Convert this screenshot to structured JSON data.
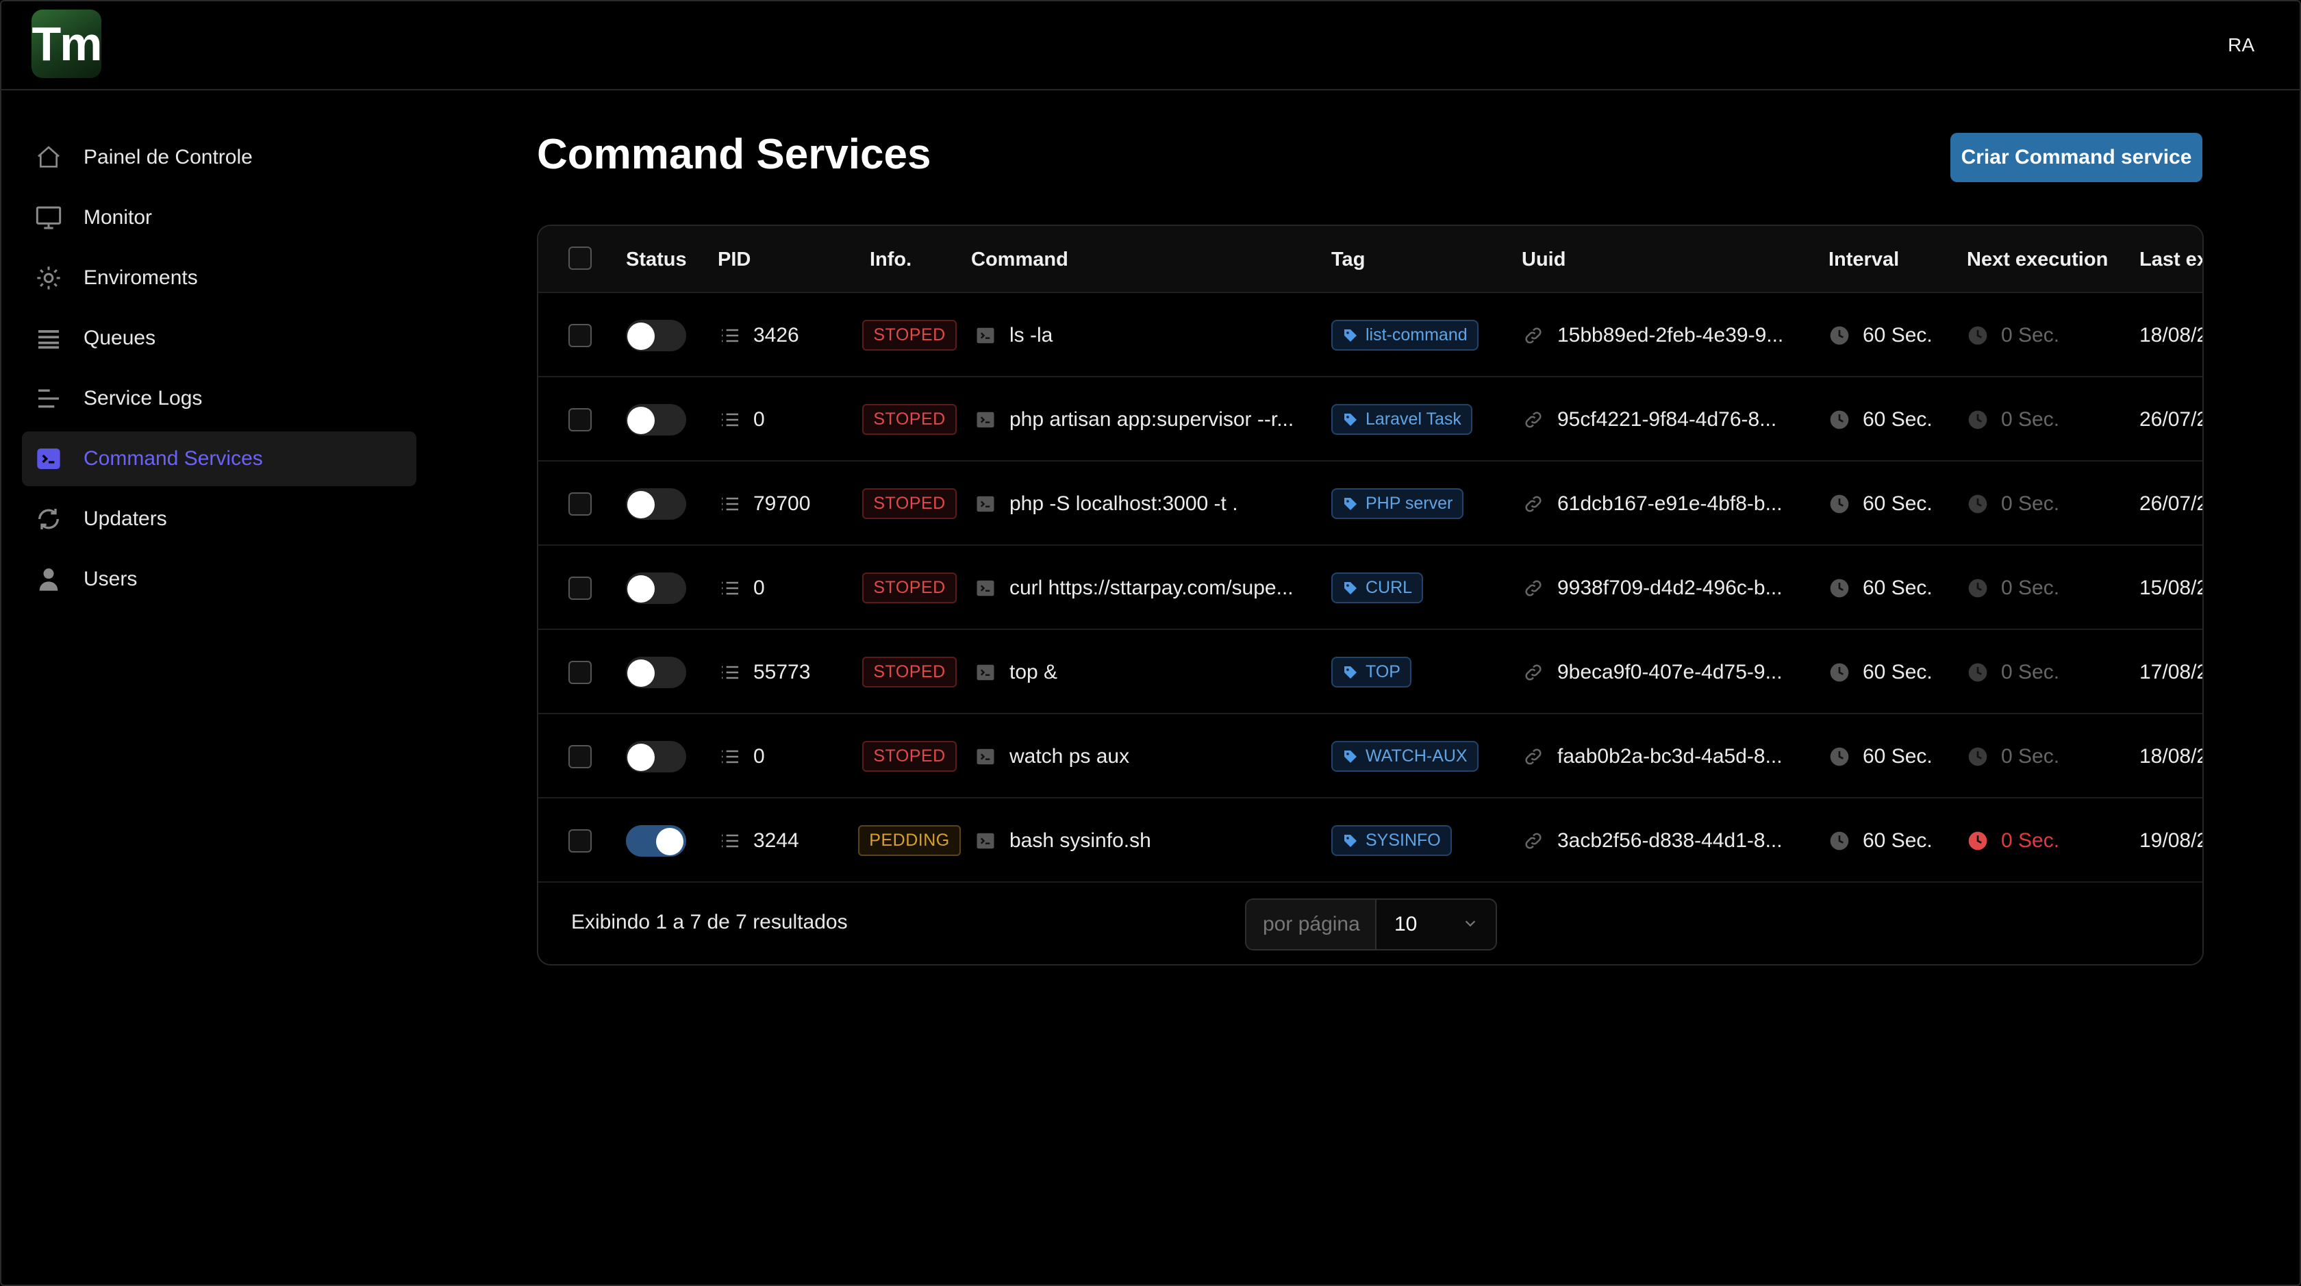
{
  "app": {
    "logo_text": "Tm",
    "user_initials": "RA"
  },
  "sidebar": {
    "items": [
      {
        "label": "Painel de Controle",
        "icon": "home-icon",
        "active": false
      },
      {
        "label": "Monitor",
        "icon": "monitor-icon",
        "active": false
      },
      {
        "label": "Enviroments",
        "icon": "gear-icon",
        "active": false
      },
      {
        "label": "Queues",
        "icon": "queue-icon",
        "active": false
      },
      {
        "label": "Service Logs",
        "icon": "logs-icon",
        "active": false
      },
      {
        "label": "Command Services",
        "icon": "terminal-icon",
        "active": true
      },
      {
        "label": "Updaters",
        "icon": "refresh-icon",
        "active": false
      },
      {
        "label": "Users",
        "icon": "user-icon",
        "active": false
      }
    ]
  },
  "page": {
    "title": "Command Services",
    "create_button": "Criar Command service"
  },
  "table": {
    "columns": [
      "Status",
      "PID",
      "Info.",
      "Command",
      "Tag",
      "Uuid",
      "Interval",
      "Next execution",
      "Last ex"
    ],
    "rows": [
      {
        "enabled": false,
        "pid": "3426",
        "info": "STOPED",
        "command": "ls -la",
        "tag": "list-command",
        "uuid": "15bb89ed-2feb-4e39-9...",
        "interval": "60 Sec.",
        "next": "0 Sec.",
        "last": "18/08/2"
      },
      {
        "enabled": false,
        "pid": "0",
        "info": "STOPED",
        "command": "php artisan app:supervisor --r...",
        "tag": "Laravel Task",
        "uuid": "95cf4221-9f84-4d76-8...",
        "interval": "60 Sec.",
        "next": "0 Sec.",
        "last": "26/07/2"
      },
      {
        "enabled": false,
        "pid": "79700",
        "info": "STOPED",
        "command": "php -S localhost:3000 -t .",
        "tag": "PHP server",
        "uuid": "61dcb167-e91e-4bf8-b...",
        "interval": "60 Sec.",
        "next": "0 Sec.",
        "last": "26/07/2"
      },
      {
        "enabled": false,
        "pid": "0",
        "info": "STOPED",
        "command": "curl https://sttarpay.com/supe...",
        "tag": "CURL",
        "uuid": "9938f709-d4d2-496c-b...",
        "interval": "60 Sec.",
        "next": "0 Sec.",
        "last": "15/08/2"
      },
      {
        "enabled": false,
        "pid": "55773",
        "info": "STOPED",
        "command": "top &",
        "tag": "TOP",
        "uuid": "9beca9f0-407e-4d75-9...",
        "interval": "60 Sec.",
        "next": "0 Sec.",
        "last": "17/08/2"
      },
      {
        "enabled": false,
        "pid": "0",
        "info": "STOPED",
        "command": "watch ps aux",
        "tag": "WATCH-AUX",
        "uuid": "faab0b2a-bc3d-4a5d-8...",
        "interval": "60 Sec.",
        "next": "0 Sec.",
        "last": "18/08/2"
      },
      {
        "enabled": true,
        "pid": "3244",
        "info": "PEDDING",
        "command": "bash sysinfo.sh",
        "tag": "SYSINFO",
        "uuid": "3acb2f56-d838-44d1-8...",
        "interval": "60 Sec.",
        "next": "0 Sec.",
        "last": "19/08/2"
      }
    ]
  },
  "footer": {
    "summary": "Exibindo 1 a 7 de 7 resultados",
    "per_page_label": "por página",
    "per_page_value": "10"
  },
  "colors": {
    "accent": "#5b55e8",
    "primary_button": "#2a6fa6",
    "stoped": "#e04a4a",
    "pending": "#d8a02e",
    "tag": "#5fa5e6"
  }
}
